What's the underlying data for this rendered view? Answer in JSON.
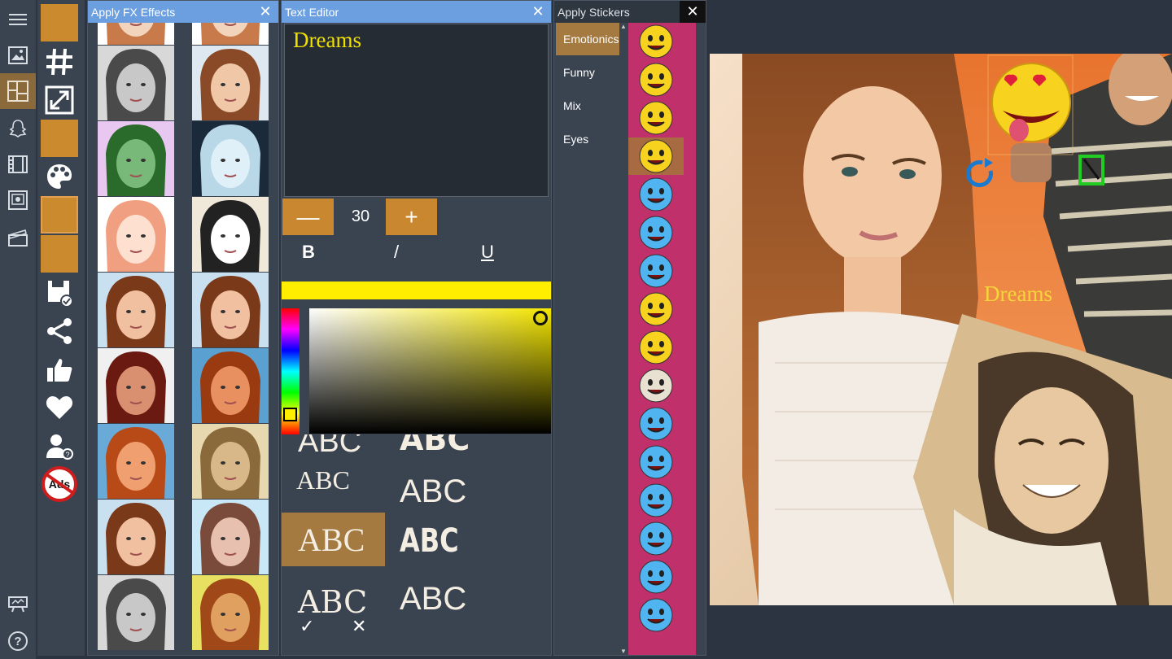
{
  "nav": {
    "items": [
      {
        "icon": "hamburger-menu-icon"
      },
      {
        "icon": "photo-icon"
      },
      {
        "icon": "collage-layout-icon",
        "active": true
      },
      {
        "icon": "snapchat-ghost-icon"
      },
      {
        "icon": "filmstrip-icon"
      },
      {
        "icon": "photo-frame-icon"
      },
      {
        "icon": "clapperboard-icon"
      }
    ],
    "bottom": [
      {
        "icon": "sign-board-icon"
      },
      {
        "icon": "help-icon"
      }
    ],
    "help_label": "?"
  },
  "tools": {
    "accent": "#cc8a2e",
    "ads_label": "Ads"
  },
  "fx_panel": {
    "title": "Apply FX Effects",
    "close": "✕",
    "thumbnails": [
      {
        "filter": "fade-top",
        "col": 0
      },
      {
        "filter": "fade-top",
        "col": 1
      },
      {
        "filter": "grayscale",
        "col": 0
      },
      {
        "filter": "normal-bright",
        "col": 1
      },
      {
        "filter": "green-tint",
        "col": 0
      },
      {
        "filter": "invert",
        "col": 1
      },
      {
        "filter": "overexposed",
        "col": 0
      },
      {
        "filter": "sketch",
        "col": 1
      },
      {
        "filter": "normal",
        "col": 0
      },
      {
        "filter": "normal",
        "col": 1
      },
      {
        "filter": "posterize",
        "col": 0
      },
      {
        "filter": "warm-blue-bg",
        "col": 1
      },
      {
        "filter": "warm-selected",
        "col": 0
      },
      {
        "filter": "sepia",
        "col": 1
      },
      {
        "filter": "normal",
        "col": 0
      },
      {
        "filter": "cool",
        "col": 1
      },
      {
        "filter": "grayscale",
        "col": 0
      },
      {
        "filter": "yellow-bg",
        "col": 1
      }
    ]
  },
  "text_editor": {
    "title": "Text Editor",
    "close": "✕",
    "text": "Dreams",
    "minus": "—",
    "size": "30",
    "plus": "+",
    "bold": "B",
    "italic": "/",
    "underline": "U",
    "selected_color": "#ffee00",
    "font_samples": [
      "ABC",
      "ABC",
      "ABC",
      "ABC",
      "ABC",
      "ABC",
      "ABC",
      "ABC"
    ],
    "ok": "✓",
    "cancel": "✕"
  },
  "stickers_panel": {
    "title": "Apply Stickers",
    "close": "✕",
    "categories": [
      {
        "label": "Emotionics",
        "selected": true
      },
      {
        "label": "Funny"
      },
      {
        "label": "Mix"
      },
      {
        "label": "Eyes"
      }
    ],
    "stickers": [
      {
        "icon": "surprised-emoji-icon"
      },
      {
        "icon": "laughing-emoji-icon"
      },
      {
        "icon": "cool-sunglasses-emoji-icon"
      },
      {
        "icon": "heart-eyes-emoji-icon",
        "selected": true
      },
      {
        "icon": "blue-smile-emoji-icon"
      },
      {
        "icon": "blue-cat-emoji-icon"
      },
      {
        "icon": "blue-laugh-emoji-icon"
      },
      {
        "icon": "crown-emoji-icon"
      },
      {
        "icon": "smirk-emoji-icon"
      },
      {
        "icon": "mummy-emoji-icon"
      },
      {
        "icon": "devil-emoji-icon"
      },
      {
        "icon": "blue-tongue-emoji-icon"
      },
      {
        "icon": "blue-heart-eyes-emoji-icon"
      },
      {
        "icon": "blue-shocked-emoji-icon"
      },
      {
        "icon": "santa-emoji-icon"
      },
      {
        "icon": "blue-angry-emoji-icon"
      }
    ]
  },
  "canvas": {
    "overlay_text": "Dreams",
    "overlay_color": "#f5d63a"
  }
}
